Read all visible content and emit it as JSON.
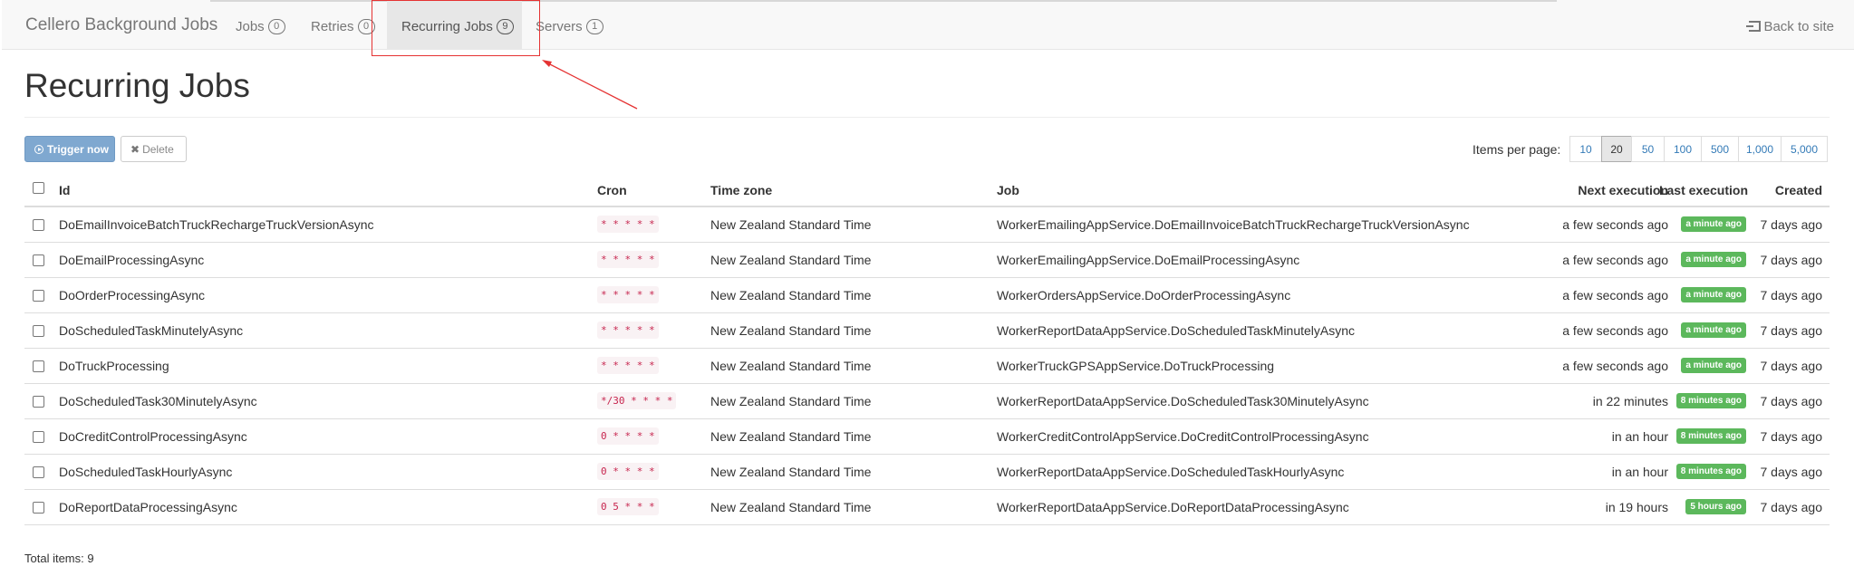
{
  "navbar": {
    "brand": "Cellero Background Jobs",
    "items": [
      {
        "label": "Jobs",
        "count": "0"
      },
      {
        "label": "Retries",
        "count": "0"
      },
      {
        "label": "Recurring Jobs",
        "count": "9"
      },
      {
        "label": "Servers",
        "count": "1"
      }
    ],
    "back_link": "Back to site"
  },
  "page": {
    "title": "Recurring Jobs",
    "trigger_label": "Trigger now",
    "delete_label": "Delete",
    "items_per_page_label": "Items per page:",
    "page_sizes": [
      "10",
      "20",
      "50",
      "100",
      "500",
      "1,000",
      "5,000"
    ],
    "selected_page_size": "20",
    "total_label": "Total items: 9"
  },
  "table": {
    "headers": {
      "id": "Id",
      "cron": "Cron",
      "timezone": "Time zone",
      "job": "Job",
      "next": "Next execution",
      "last": "Last execution",
      "created": "Created"
    },
    "rows": [
      {
        "id": "DoEmailInvoiceBatchTruckRechargeTruckVersionAsync",
        "cron": "* * * * *",
        "timezone": "New Zealand Standard Time",
        "job": "WorkerEmailingAppService.DoEmailInvoiceBatchTruckRechargeTruckVersionAsync",
        "next": "a few seconds ago",
        "last": "a minute ago",
        "created": "7 days ago"
      },
      {
        "id": "DoEmailProcessingAsync",
        "cron": "* * * * *",
        "timezone": "New Zealand Standard Time",
        "job": "WorkerEmailingAppService.DoEmailProcessingAsync",
        "next": "a few seconds ago",
        "last": "a minute ago",
        "created": "7 days ago"
      },
      {
        "id": "DoOrderProcessingAsync",
        "cron": "* * * * *",
        "timezone": "New Zealand Standard Time",
        "job": "WorkerOrdersAppService.DoOrderProcessingAsync",
        "next": "a few seconds ago",
        "last": "a minute ago",
        "created": "7 days ago"
      },
      {
        "id": "DoScheduledTaskMinutelyAsync",
        "cron": "* * * * *",
        "timezone": "New Zealand Standard Time",
        "job": "WorkerReportDataAppService.DoScheduledTaskMinutelyAsync",
        "next": "a few seconds ago",
        "last": "a minute ago",
        "created": "7 days ago"
      },
      {
        "id": "DoTruckProcessing",
        "cron": "* * * * *",
        "timezone": "New Zealand Standard Time",
        "job": "WorkerTruckGPSAppService.DoTruckProcessing",
        "next": "a few seconds ago",
        "last": "a minute ago",
        "created": "7 days ago"
      },
      {
        "id": "DoScheduledTask30MinutelyAsync",
        "cron": "*/30 * * * *",
        "timezone": "New Zealand Standard Time",
        "job": "WorkerReportDataAppService.DoScheduledTask30MinutelyAsync",
        "next": "in 22 minutes",
        "last": "8 minutes ago",
        "created": "7 days ago"
      },
      {
        "id": "DoCreditControlProcessingAsync",
        "cron": "0 * * * *",
        "timezone": "New Zealand Standard Time",
        "job": "WorkerCreditControlAppService.DoCreditControlProcessingAsync",
        "next": "in an hour",
        "last": "8 minutes ago",
        "created": "7 days ago"
      },
      {
        "id": "DoScheduledTaskHourlyAsync",
        "cron": "0 * * * *",
        "timezone": "New Zealand Standard Time",
        "job": "WorkerReportDataAppService.DoScheduledTaskHourlyAsync",
        "next": "in an hour",
        "last": "8 minutes ago",
        "created": "7 days ago"
      },
      {
        "id": "DoReportDataProcessingAsync",
        "cron": "0 5 * * *",
        "timezone": "New Zealand Standard Time",
        "job": "WorkerReportDataAppService.DoReportDataProcessingAsync",
        "next": "in 19 hours",
        "last": "5 hours ago",
        "created": "7 days ago"
      }
    ]
  },
  "colors": {
    "accent": "#337ab7",
    "success": "#5cb85c",
    "cron_text": "#c7254e",
    "annotation": "#e53333"
  }
}
